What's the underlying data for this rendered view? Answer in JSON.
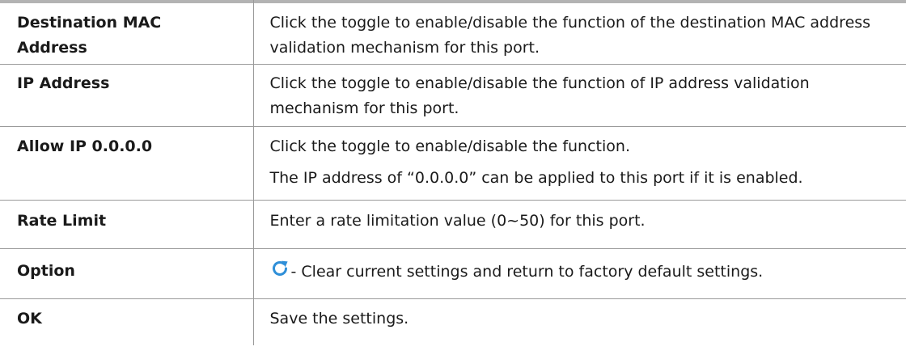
{
  "rows": [
    {
      "term": "Destination MAC Address",
      "description": [
        "Click the toggle to enable/disable the function of the destination MAC address validation mechanism for this port."
      ]
    },
    {
      "term": "IP Address",
      "description": [
        "Click the toggle to enable/disable the function of IP address validation mechanism for this port."
      ]
    },
    {
      "term": "Allow IP 0.0.0.0",
      "description": [
        "Click the toggle to enable/disable the function.",
        "The IP address of “0.0.0.0” can be applied to this port if it is enabled."
      ]
    },
    {
      "term": "Rate Limit",
      "description": [
        "Enter a rate limitation value (0~50) for this port."
      ]
    },
    {
      "term": "Option",
      "icon": "refresh-icon",
      "description": [
        "- Clear current settings and return to factory default settings."
      ]
    },
    {
      "term": "OK",
      "description": [
        "Save the settings."
      ]
    }
  ],
  "colors": {
    "rule": "#b3b3b3",
    "grid": "#9a9a9a",
    "icon": "#2f8fd8"
  }
}
